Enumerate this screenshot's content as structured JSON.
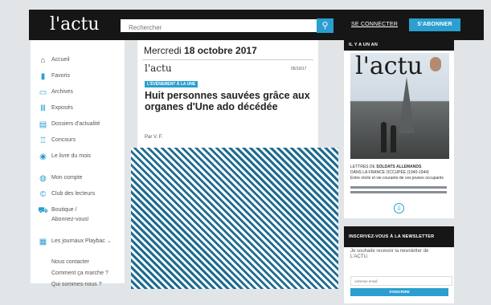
{
  "header": {
    "logo": "l'actu",
    "search_placeholder": "Rechercher",
    "search_icon": "magnifier-icon",
    "login": "SE CONNECTER",
    "subscribe": "S'ABONNER"
  },
  "sidebar": {
    "items": [
      {
        "label": "Accueil",
        "icon": "home-icon"
      },
      {
        "label": "Favoris",
        "icon": "bookmark-icon"
      },
      {
        "label": "Archives",
        "icon": "archive-icon"
      },
      {
        "label": "Exposés",
        "icon": "library-icon"
      },
      {
        "label": "Dossiers d'actualité",
        "icon": "folder-icon"
      },
      {
        "label": "Concours",
        "icon": "trophy-icon"
      },
      {
        "label": "Le livre du mois",
        "icon": "book-icon"
      },
      {
        "label": "Mon compte",
        "icon": "user-icon"
      },
      {
        "label": "Club des lecteurs",
        "icon": "club-icon"
      },
      {
        "label": "Boutique /",
        "label2": "Abonnez-vous!",
        "icon": "cart-icon"
      },
      {
        "label": "Les journaux Playbac",
        "icon": "newspaper-icon"
      }
    ],
    "links": [
      "Nous contacter",
      "Comment ça marche ?",
      "Qui sommes-nous ?"
    ]
  },
  "article": {
    "date_prefix": "Mercredi",
    "date": "18 octobre 2017",
    "logo": "l'actu",
    "issue_id": "05/10/17",
    "tag": "L'ÉVÉNEMENT À LA UNE",
    "title": "Huit personnes sauvées grâce aux organes d'Une ado décédée",
    "author": "Par V. F."
  },
  "anniversary": {
    "title": "IL Y A UN AN",
    "cover_logo": "l'actu",
    "cover_line1_prefix": "LETTRES DE ",
    "cover_line1_bold": "SOLDATS ALLEMANDS",
    "cover_line2": "DANS LA FRANCE OCCUPÉE (1940-1944)",
    "cover_line3": "Entre récits et vie courante de ces jeunes occupants",
    "download_icon": "download-icon"
  },
  "newsletter": {
    "title": "INSCRIVEZ-VOUS À LA NEWSLETTER",
    "text": "Je souhaite recevoir la newsletter de L'ACTU.",
    "email_placeholder": "Adresse email",
    "button": "S'INSCRIRE"
  },
  "colors": {
    "accent": "#2a9fd0",
    "header": "#161616"
  }
}
